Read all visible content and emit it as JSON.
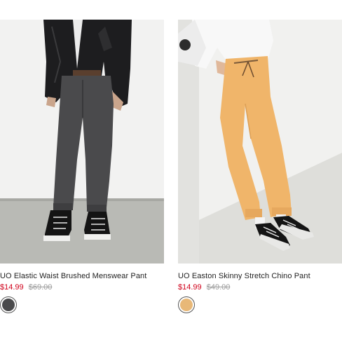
{
  "products": [
    {
      "name": "UO Elastic Waist Brushed Menswear Pant",
      "sale_price": "$14.99",
      "original_price": "$69.00",
      "swatch_color": "#4a4a4c",
      "swatch_label": "Charcoal"
    },
    {
      "name": "UO Easton Skinny Stretch Chino Pant",
      "sale_price": "$14.99",
      "original_price": "$49.00",
      "swatch_color": "#e8b878",
      "swatch_label": "Peach"
    }
  ],
  "colors": {
    "sale": "#d0021b",
    "original": "#9b9b9b",
    "title": "#222222"
  }
}
